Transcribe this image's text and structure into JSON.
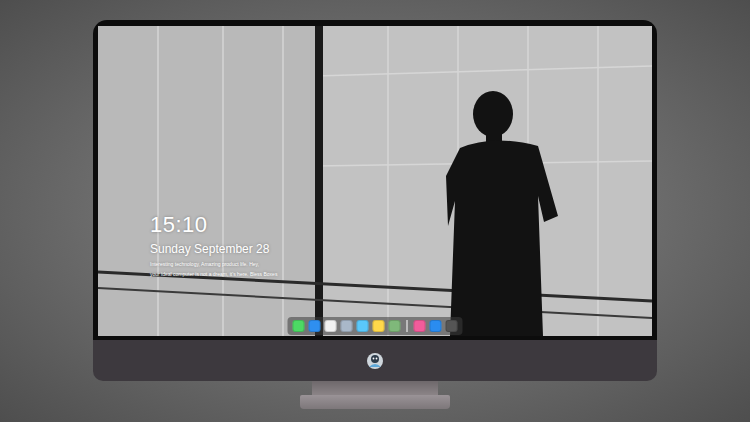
{
  "lock_screen": {
    "time": "15:10",
    "date": "Sunday September 28",
    "caption": [
      "Interesting technology, Amazing product life. Hey,",
      "your ideal computer is not a dream, it's here. Bless Boxes"
    ]
  },
  "dock": {
    "items": [
      {
        "kind": "app",
        "color": "#4cd964"
      },
      {
        "kind": "app",
        "color": "#2f8ff0"
      },
      {
        "kind": "app",
        "color": "#f2f2f2"
      },
      {
        "kind": "app",
        "color": "#a9b8c9"
      },
      {
        "kind": "app",
        "color": "#5ac8fa"
      },
      {
        "kind": "app",
        "color": "#ffd84a"
      },
      {
        "kind": "app",
        "color": "#7fb87a"
      },
      {
        "kind": "separator",
        "color": "#ffffff"
      },
      {
        "kind": "app",
        "color": "#f25c9b"
      },
      {
        "kind": "app",
        "color": "#2a8cf0"
      },
      {
        "kind": "app",
        "color": "#555555"
      }
    ]
  }
}
